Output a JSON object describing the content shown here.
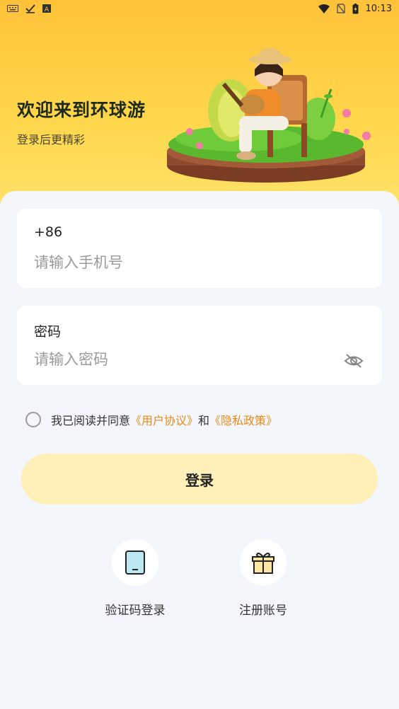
{
  "status_bar": {
    "time": "10:13",
    "icons": [
      "keyboard-icon",
      "check-icon",
      "a-badge-icon",
      "wifi-icon",
      "no-sim-icon",
      "battery-charging-icon"
    ]
  },
  "hero": {
    "title": "欢迎来到环球游",
    "subtitle": "登录后更精彩",
    "illustration": "girl-with-guitar-on-grass-platform"
  },
  "phone_card": {
    "prefix": "+86",
    "placeholder": "请输入手机号",
    "value": ""
  },
  "password_card": {
    "label": "密码",
    "placeholder": "请输入密码",
    "value": "",
    "toggle_icon": "eye-off-icon"
  },
  "agreement": {
    "text": "我已阅读并同意",
    "user_agreement": "《用户协议》",
    "conjunction": "和",
    "privacy_policy": "《隐私政策》",
    "checked": false
  },
  "login_button": {
    "label": "登录"
  },
  "alt_options": [
    {
      "label": "验证码登录",
      "icon": "phone-icon"
    },
    {
      "label": "注册账号",
      "icon": "gift-icon"
    }
  ],
  "colors": {
    "accent": "#e88a1a",
    "hero_top": "#ffc23a",
    "hero_bottom": "#ffe36b",
    "button_bg": "#ffefb8",
    "page_bg": "#f3f6fa"
  }
}
